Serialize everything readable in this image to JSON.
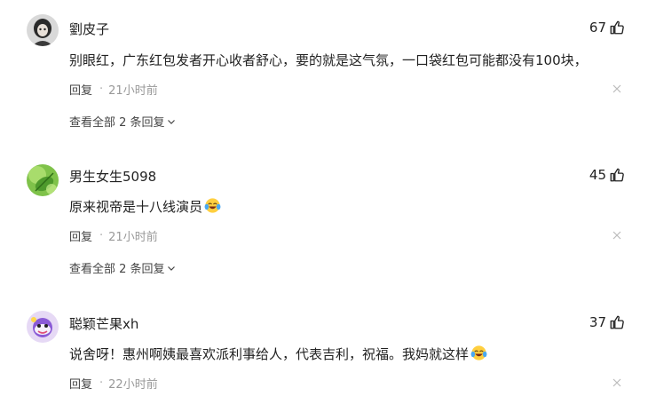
{
  "comments": [
    {
      "username": "劉皮子",
      "likes": "67",
      "text": "别眼红，广东红包发者开心收者舒心，要的就是这气氛，一口袋红包可能都没有100块，",
      "reply_label": "回复",
      "separator": "·",
      "time": "21小时前",
      "expand_label": "查看全部 2 条回复",
      "avatar_icon": "dark-portrait-avatar"
    },
    {
      "username": "男生女生5098",
      "likes": "45",
      "text": "原来视帝是十八线演员",
      "emoji": "laughing-crying-emoji",
      "reply_label": "回复",
      "separator": "·",
      "time": "21小时前",
      "expand_label": "查看全部 2 条回复",
      "avatar_icon": "green-leaf-avatar"
    },
    {
      "username": "聪颖芒果xh",
      "likes": "37",
      "text": "说舍呀！惠州啊姨最喜欢派利事给人，代表吉利，祝福。我妈就这样",
      "emoji": "laughing-crying-emoji",
      "reply_label": "回复",
      "separator": "·",
      "time": "22小时前",
      "avatar_icon": "purple-cartoon-avatar"
    }
  ],
  "colors": {
    "text": "#222222",
    "meta": "#999999",
    "avatar_bg_3": "#e6d9f5"
  }
}
